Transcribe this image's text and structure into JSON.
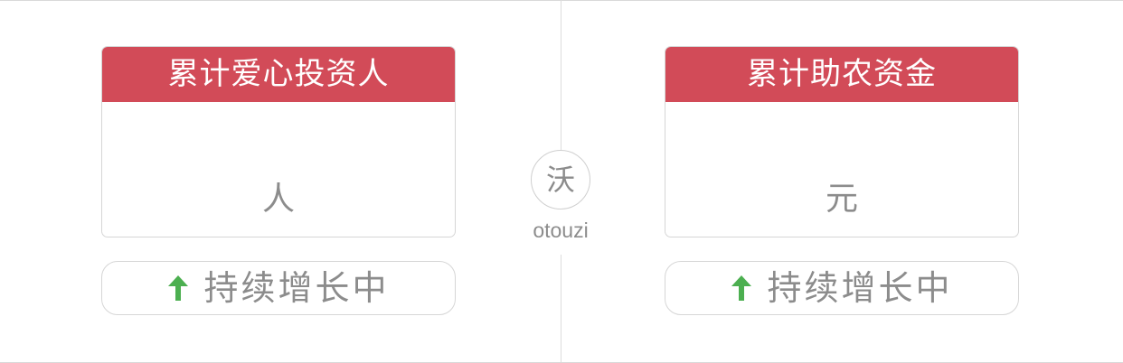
{
  "left_card": {
    "title": "累计爱心投资人",
    "unit": "人"
  },
  "right_card": {
    "title": "累计助农资金",
    "unit": "元"
  },
  "left_status": {
    "icon": "arrow-up-icon",
    "text": "持续增长中"
  },
  "right_status": {
    "icon": "arrow-up-icon",
    "text": "持续增长中"
  },
  "logo": {
    "char": "沃",
    "text": "otouzi"
  },
  "colors": {
    "header_red": "#d24b58",
    "arrow_green": "#4caf50",
    "muted_gray": "#8c8c8c",
    "border_gray": "#d6d6d6"
  }
}
